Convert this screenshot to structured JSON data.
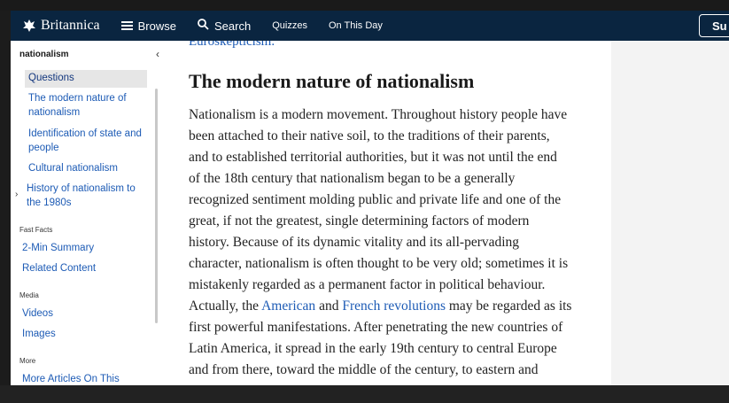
{
  "navbar": {
    "logo_text": "Britannica",
    "browse_label": "Browse",
    "search_label": "Search",
    "quizzes_label": "Quizzes",
    "on_this_day_label": "On This Day",
    "subscribe_label": "Su"
  },
  "sidebar": {
    "title": "nationalism",
    "toc": [
      {
        "label": "Questions"
      },
      {
        "label_lines": [
          "The modern nature of",
          "nationalism"
        ]
      },
      {
        "label_lines": [
          "Identification of state and",
          "people"
        ]
      },
      {
        "label": "Cultural nationalism"
      },
      {
        "label_lines": [
          "History of nationalism to",
          "the 1980s"
        ]
      }
    ],
    "fast_facts_heading": "Fast Facts",
    "fast_facts": [
      "2-Min Summary",
      "Related Content"
    ],
    "media_heading": "Media",
    "media": [
      "Videos",
      "Images"
    ],
    "more_heading": "More",
    "more": [
      "More Articles On This"
    ]
  },
  "article": {
    "prev_link": "Euroskepticism.",
    "heading": "The modern nature of nationalism",
    "lines": [
      "Nationalism is a modern movement. Throughout history people have",
      "been attached to their native soil, to the traditions of their parents,",
      "and to established territorial authorities, but it was not until the end",
      "of the 18th century that nationalism began to be a generally",
      "recognized sentiment molding public and private life and one of the",
      "great, if not the greatest, single determining factors of modern",
      "history. Because of its dynamic vitality and its all-pervading",
      "character, nationalism is often thought to be very old; sometimes it is",
      "mistakenly regarded as a permanent factor in political behaviour."
    ],
    "line10": {
      "pre": "Actually, the ",
      "link1": "American",
      "mid": " and ",
      "link2": "French revolutions",
      "post": " may be regarded as its"
    },
    "lines_after": [
      "first powerful manifestations. After penetrating the new countries of",
      "Latin America, it spread in the early 19th century to central Europe",
      "and from there, toward the middle of the century, to eastern and"
    ]
  }
}
